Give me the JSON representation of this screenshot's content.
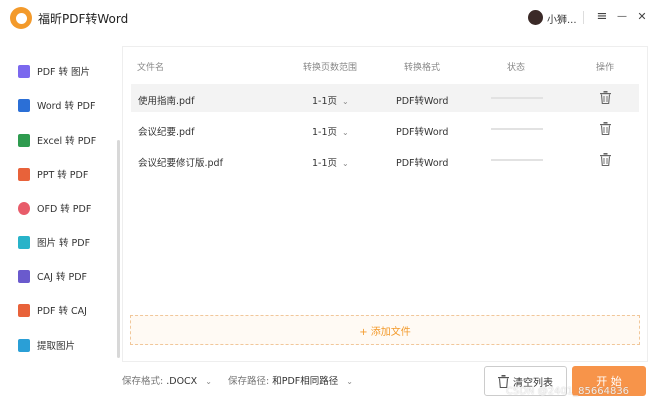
{
  "app": {
    "title": "福昕PDF转Word",
    "user": "小狮...",
    "accent": "#f39a2b"
  },
  "window_controls": {
    "menu": "≡",
    "minimize": "—",
    "close": "✕"
  },
  "sidebar": {
    "items": [
      {
        "label": "PDF 转 图片",
        "color": "#7b68ee",
        "icon": "image-icon"
      },
      {
        "label": "Word 转 PDF",
        "color": "#2b6fd6",
        "icon": "word-icon"
      },
      {
        "label": "Excel 转 PDF",
        "color": "#2e9b4f",
        "icon": "excel-icon"
      },
      {
        "label": "PPT 转 PDF",
        "color": "#e8623a",
        "icon": "ppt-icon"
      },
      {
        "label": "OFD 转 PDF",
        "color": "#e85c6a",
        "icon": "ofd-icon"
      },
      {
        "label": "图片 转 PDF",
        "color": "#28b3c9",
        "icon": "picture-icon"
      },
      {
        "label": "CAJ 转 PDF",
        "color": "#6a5acd",
        "icon": "caj-icon"
      },
      {
        "label": "PDF 转 CAJ",
        "color": "#e8623a",
        "icon": "pdf-icon"
      },
      {
        "label": "提取图片",
        "color": "#2a9fd6",
        "icon": "extract-image-icon"
      }
    ]
  },
  "table": {
    "headers": {
      "filename": "文件名",
      "range": "转换页数范围",
      "format": "转换格式",
      "status": "状态",
      "action": "操作"
    },
    "rows": [
      {
        "filename": "使用指南.pdf",
        "range": "1-1页",
        "format": "PDF转Word",
        "selected": true
      },
      {
        "filename": "会议纪要.pdf",
        "range": "1-1页",
        "format": "PDF转Word",
        "selected": false
      },
      {
        "filename": "会议纪要修订版.pdf",
        "range": "1-1页",
        "format": "PDF转Word",
        "selected": false
      }
    ]
  },
  "add_file": {
    "label": "+ 添加文件"
  },
  "footer": {
    "save_format_label": "保存格式:",
    "save_format_value": ".DOCX",
    "save_path_label": "保存路径:",
    "save_path_value": "和PDF相同路径",
    "clear_label": "清空列表",
    "start_label": "开 始"
  },
  "watermark": "CSDN @2401_85664836"
}
